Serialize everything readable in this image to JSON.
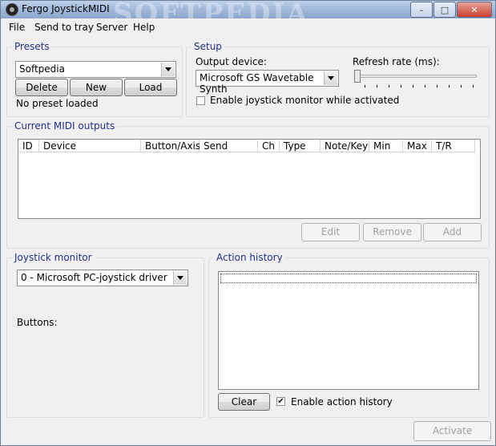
{
  "window": {
    "title": "Fergo JoystickMIDI",
    "watermark": "SOFTPEDIA",
    "controls": {
      "minimize": "–",
      "maximize": "□",
      "close": "✕"
    }
  },
  "menu": [
    "File",
    "Send to tray",
    "Server",
    "Help"
  ],
  "presets": {
    "legend": "Presets",
    "selected": "Softpedia",
    "buttons": {
      "delete": "Delete",
      "new": "New",
      "load": "Load"
    },
    "status": "No preset loaded"
  },
  "setup": {
    "legend": "Setup",
    "output_device_label": "Output device:",
    "output_device_value": "Microsoft GS Wavetable Synth",
    "refresh_rate_label": "Refresh rate (ms):",
    "refresh_rate_level": 0,
    "monitor_checkbox_label": "Enable joystick monitor while activated",
    "monitor_checked": false
  },
  "midi_outputs": {
    "legend": "Current MIDI outputs",
    "columns": [
      "ID",
      "Device",
      "Button/Axis",
      "Send",
      "Ch",
      "Type",
      "Note/Key",
      "Min",
      "Max",
      "T/R"
    ],
    "rows": [],
    "buttons": {
      "edit": "Edit",
      "remove": "Remove",
      "add": "Add"
    }
  },
  "joystick_monitor": {
    "legend": "Joystick monitor",
    "selected": "0 - Microsoft PC-joystick driver",
    "buttons_label": "Buttons:"
  },
  "action_history": {
    "legend": "Action history",
    "items": [],
    "clear_label": "Clear",
    "enable_label": "Enable action history",
    "enabled": true,
    "check_glyph": "✔"
  },
  "activate_label": "Activate"
}
